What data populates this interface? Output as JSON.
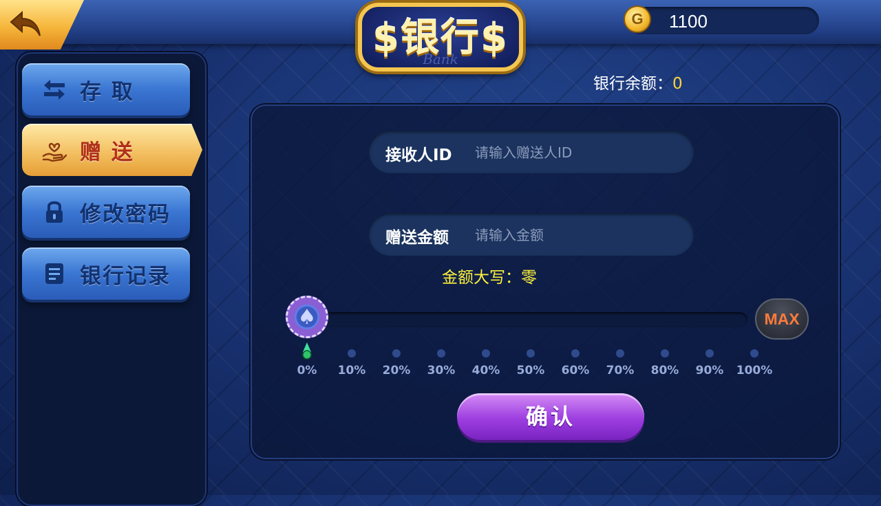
{
  "header": {
    "title": "$银行$",
    "title_sub": "Bank",
    "coins": "1100",
    "coin_symbol": "G",
    "balance_label": "银行余额：",
    "balance_value": "0"
  },
  "sidebar": {
    "items": [
      {
        "label": "存 取",
        "icon": "transfer-arrows-icon",
        "active": false
      },
      {
        "label": "赠 送",
        "icon": "hand-heart-icon",
        "active": true
      },
      {
        "label": "修改密码",
        "icon": "lock-icon",
        "active": false
      },
      {
        "label": "银行记录",
        "icon": "document-icon",
        "active": false
      }
    ]
  },
  "form": {
    "receiver_label": "接收人ID",
    "receiver_placeholder": "请输入赠送人ID",
    "amount_label": "赠送金额",
    "amount_placeholder": "请输入金额",
    "amount_words": "金额大写：零"
  },
  "slider": {
    "value_percent": 0,
    "max_label": "MAX",
    "ticks": [
      "0%",
      "10%",
      "20%",
      "30%",
      "40%",
      "50%",
      "60%",
      "70%",
      "80%",
      "90%",
      "100%"
    ]
  },
  "confirm_label": "确认",
  "colors": {
    "accent_gold": "#f3c062",
    "accent_purple": "#9d3ee0",
    "highlight_yellow": "#fff23c"
  }
}
